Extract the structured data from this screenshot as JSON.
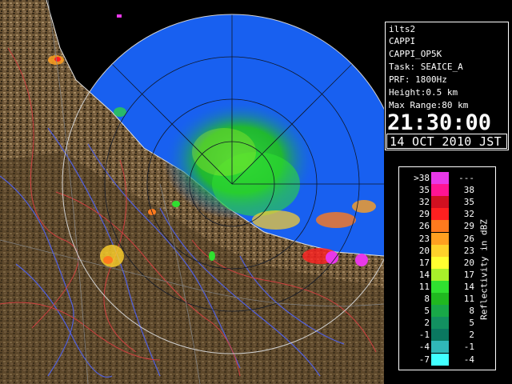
{
  "info": {
    "site": "ilts2",
    "product": "CAPPI",
    "product_name": "CAPPI_OP5K",
    "task": "Task: SEAICE_A",
    "prf": "PRF: 1800Hz",
    "height": "Height:0.5 km",
    "max_range": "Max Range:80 km",
    "time": "21:30:00",
    "date": "14 OCT 2010 JST"
  },
  "legend": {
    "title": "Reflectivity in dBZ",
    "rows": [
      {
        "low": ">38",
        "high": "---",
        "color": "#e838e8"
      },
      {
        "low": "35",
        "high": "38",
        "color": "#ff1493"
      },
      {
        "low": "32",
        "high": "35",
        "color": "#d01020"
      },
      {
        "low": "29",
        "high": "32",
        "color": "#ff2020"
      },
      {
        "low": "26",
        "high": "29",
        "color": "#ff7a1e"
      },
      {
        "low": "23",
        "high": "26",
        "color": "#ffa020"
      },
      {
        "low": "20",
        "high": "23",
        "color": "#ffd22a"
      },
      {
        "low": "17",
        "high": "20",
        "color": "#ffff30"
      },
      {
        "low": "14",
        "high": "17",
        "color": "#a8f02a"
      },
      {
        "low": "11",
        "high": "14",
        "color": "#30e030"
      },
      {
        "low": "8",
        "high": "11",
        "color": "#20b820"
      },
      {
        "low": "5",
        "high": "8",
        "color": "#18a848"
      },
      {
        "low": "2",
        "high": "5",
        "color": "#129060"
      },
      {
        "low": "-1",
        "high": "2",
        "color": "#0a7860"
      },
      {
        "low": "-4",
        "high": "-1",
        "color": "#30b8b8"
      },
      {
        "low": "-7",
        "high": "-4",
        "color": "#40ffff"
      }
    ]
  },
  "colors": {
    "sea": "#1860f0",
    "background": "#000000",
    "land": "#6e5636",
    "rivers": "#5060e0",
    "boundaries": "#d04040"
  }
}
